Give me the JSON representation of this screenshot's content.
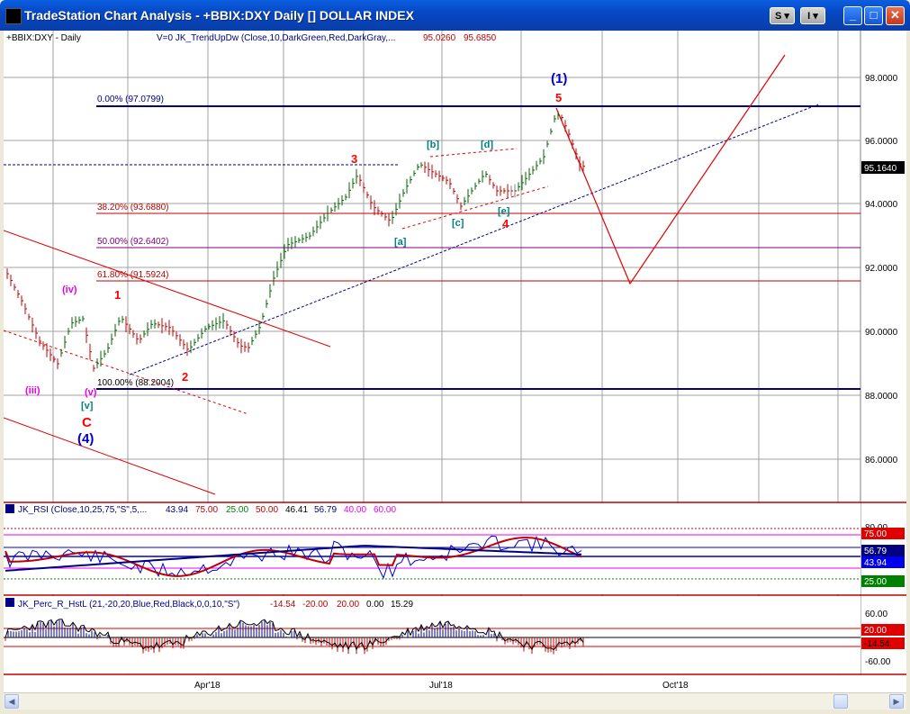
{
  "window": {
    "title": "TradeStation Chart Analysis - +BBIX:DXY Daily [] DOLLAR INDEX",
    "btn_s": "S",
    "btn_i": "I",
    "minimize": "_",
    "maximize": "□",
    "close": "✕"
  },
  "main": {
    "symbol_label": "+BBIX:DXY - Daily",
    "indicator_label": "V=0  JK_TrendUpDw (Close,10,DarkGreen,Red,DarkGray,...",
    "indicator_v1": "95.0260",
    "indicator_v2": "95.6850",
    "price_axis": [
      "98.0000",
      "96.0000",
      "94.0000",
      "92.0000",
      "90.0000",
      "88.0000",
      "86.0000"
    ],
    "last_price": "95.1640",
    "fib_levels": [
      {
        "label": "0.00% (97.0799)"
      },
      {
        "label": "38.20% (93.6880)"
      },
      {
        "label": "50.00% (92.6402)"
      },
      {
        "label": "61.80% (91.5924)"
      },
      {
        "label": "100.00% (88.2004)"
      }
    ],
    "wave_labels": {
      "w_1_blue": "(1)",
      "w_4_blue": "(4)",
      "w_5": "5",
      "w_3": "3",
      "w_1": "1",
      "w_2": "2",
      "w_4": "4",
      "w_C": "C",
      "w_iv": "(iv)",
      "w_iii": "(iii)",
      "w_v_pink": "(v)",
      "w_v_box": "[v]",
      "w_a": "[a]",
      "w_b": "[b]",
      "w_c": "[c]",
      "w_d": "[d]",
      "w_e": "[e]"
    }
  },
  "rsi": {
    "label": "JK_RSI (Close,10,25,75,\"S\",5,...",
    "v1": "43.94",
    "v2": "75.00",
    "v3": "25.00",
    "v4": "50.00",
    "v5": "46.41",
    "v6": "56.79",
    "v7": "40.00",
    "v8": "60.00",
    "axis_80": "80.00",
    "badge_75": "75.00",
    "badge_5679": "56.79",
    "badge_4394": "43.94",
    "badge_25": "25.00"
  },
  "percr": {
    "label": "JK_Perc_R_HstL (21,-20,20,Blue,Red,Black,0,0,10,\"S\")",
    "v1": "-14.54",
    "v2": "-20.00",
    "v3": "20.00",
    "v4": "0.00",
    "v5": "15.29",
    "axis_60": "60.00",
    "axis_m60": "-60.00",
    "badge_20": "20.00",
    "badge_m1454": "-14.54"
  },
  "time_axis": [
    "Apr'18",
    "Jul'18",
    "Oct'18"
  ],
  "colors": {
    "titlebar": "#0a5fe0",
    "fib_blue": "#000080",
    "fib_red": "#c00000",
    "fib_purple": "#800080",
    "bull_bar": "#006400",
    "bear_bar": "#c00000",
    "wave_red": "#ff0000",
    "wave_blue": "#0000cc",
    "wave_teal": "#008080",
    "wave_magenta": "#ee00ee"
  }
}
